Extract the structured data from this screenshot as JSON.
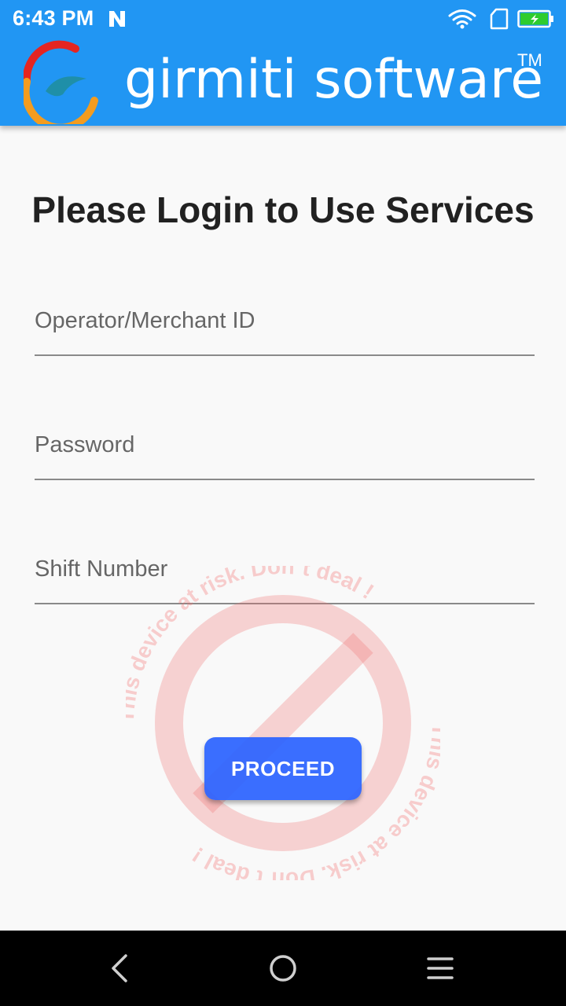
{
  "status_bar": {
    "time": "6:43 PM",
    "icons": [
      "notification-n-icon",
      "wifi-icon",
      "sim-card-icon",
      "battery-charging-icon"
    ],
    "battery_color": "#2ecc2e"
  },
  "header": {
    "brand_name": "girmiti software",
    "trademark": "TM",
    "background_color": "#2196f3"
  },
  "main": {
    "title": "Please Login to Use Services",
    "fields": [
      {
        "placeholder": "Operator/Merchant ID",
        "value": ""
      },
      {
        "placeholder": "Password",
        "value": ""
      },
      {
        "placeholder": "Shift Number",
        "value": ""
      }
    ],
    "proceed_label": "PROCEED",
    "accent_color": "#2962ff"
  },
  "watermark": {
    "text": "This device at risk. Don`t deal !",
    "color": "#f26d6d"
  },
  "nav_bar": {
    "icons": [
      "back-icon",
      "home-icon",
      "menu-icon"
    ]
  }
}
